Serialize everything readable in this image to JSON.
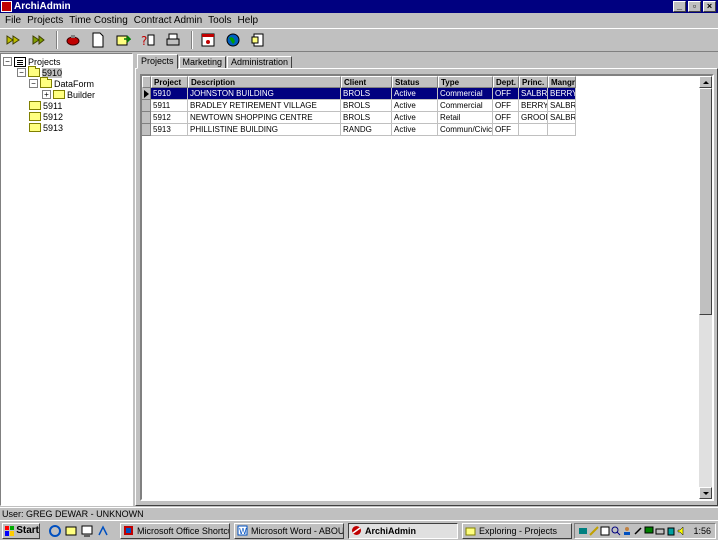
{
  "window": {
    "title": "ArchiAdmin"
  },
  "menu": [
    "File",
    "Projects",
    "Time Costing",
    "Contract Admin",
    "Tools",
    "Help"
  ],
  "toolbar": {
    "groups": [
      [
        "forward-icon",
        "back-icon"
      ],
      [
        "tools-icon",
        "new-document-icon",
        "export-icon",
        "help-icon",
        "print-icon"
      ],
      [
        "calendar-icon",
        "globe-icon",
        "report-icon"
      ]
    ]
  },
  "tree": {
    "root": "Projects",
    "items": [
      {
        "label": "5910",
        "level": 1,
        "expanded": true,
        "selected": true
      },
      {
        "label": "DataForm",
        "level": 2,
        "expanded": true
      },
      {
        "label": "Builder",
        "level": 3,
        "expanded": false
      },
      {
        "label": "5911",
        "level": 1
      },
      {
        "label": "5912",
        "level": 1
      },
      {
        "label": "5913",
        "level": 1
      }
    ]
  },
  "tabs": [
    "Projects",
    "Marketing",
    "Administration"
  ],
  "active_tab": 0,
  "grid": {
    "columns": [
      "Project",
      "Description",
      "Client",
      "Status",
      "Type",
      "Dept.",
      "Princ.",
      "Mangr"
    ],
    "rows": [
      [
        "5910",
        "JOHNSTON BUILDING",
        "BROLS",
        "Active",
        "Commercial",
        "OFF",
        "SALBRY",
        "BERRY"
      ],
      [
        "5911",
        "BRADLEY RETIREMENT VILLAGE",
        "BROLS",
        "Active",
        "Commercial",
        "OFF",
        "BERRY",
        "SALBRY"
      ],
      [
        "5912",
        "NEWTOWN SHOPPING CENTRE",
        "BROLS",
        "Active",
        "Retail",
        "OFF",
        "GROOM",
        "SALBRY"
      ],
      [
        "5913",
        "PHILLISTINE BUILDING",
        "RANDG",
        "Active",
        "Commun/Civic",
        "OFF",
        "",
        ""
      ]
    ],
    "selected_row": 0
  },
  "status": {
    "user": "User: GREG DEWAR - UNKNOWN"
  },
  "taskbar": {
    "start": "Start",
    "tasks": [
      {
        "label": "Microsoft Office Shortcut ...",
        "icon": "office-icon",
        "active": false
      },
      {
        "label": "Microsoft Word - ABOUT ...",
        "icon": "word-icon",
        "active": false
      },
      {
        "label": "ArchiAdmin",
        "icon": "archiadmin-icon",
        "active": true
      },
      {
        "label": "Exploring - Projects",
        "icon": "explorer-icon",
        "active": false
      }
    ],
    "clock": "1:56"
  },
  "colors": {
    "titlebar": "#000080",
    "selection": "#000080",
    "face": "#c0c0c0"
  }
}
